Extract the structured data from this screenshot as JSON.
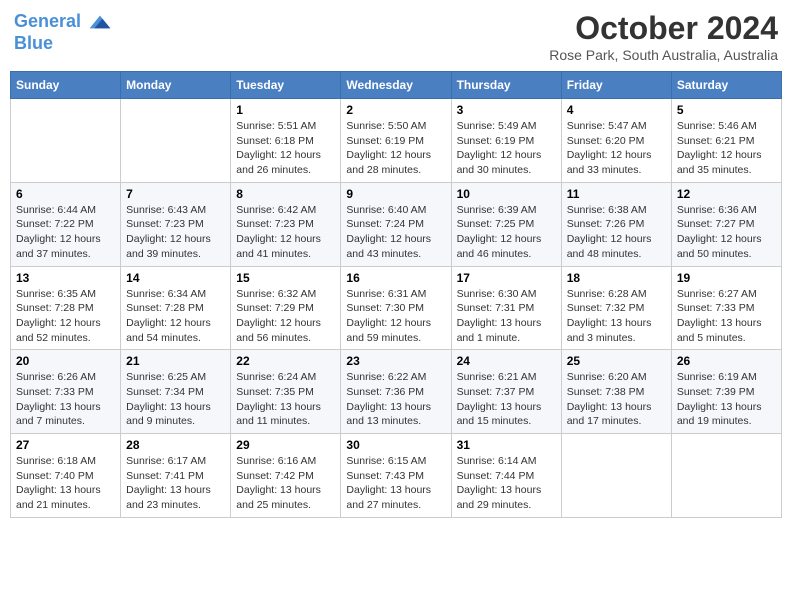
{
  "header": {
    "logo_line1": "General",
    "logo_line2": "Blue",
    "month": "October 2024",
    "location": "Rose Park, South Australia, Australia"
  },
  "days_of_week": [
    "Sunday",
    "Monday",
    "Tuesday",
    "Wednesday",
    "Thursday",
    "Friday",
    "Saturday"
  ],
  "weeks": [
    [
      {
        "day": "",
        "info": ""
      },
      {
        "day": "",
        "info": ""
      },
      {
        "day": "1",
        "info": "Sunrise: 5:51 AM\nSunset: 6:18 PM\nDaylight: 12 hours and 26 minutes."
      },
      {
        "day": "2",
        "info": "Sunrise: 5:50 AM\nSunset: 6:19 PM\nDaylight: 12 hours and 28 minutes."
      },
      {
        "day": "3",
        "info": "Sunrise: 5:49 AM\nSunset: 6:19 PM\nDaylight: 12 hours and 30 minutes."
      },
      {
        "day": "4",
        "info": "Sunrise: 5:47 AM\nSunset: 6:20 PM\nDaylight: 12 hours and 33 minutes."
      },
      {
        "day": "5",
        "info": "Sunrise: 5:46 AM\nSunset: 6:21 PM\nDaylight: 12 hours and 35 minutes."
      }
    ],
    [
      {
        "day": "6",
        "info": "Sunrise: 6:44 AM\nSunset: 7:22 PM\nDaylight: 12 hours and 37 minutes."
      },
      {
        "day": "7",
        "info": "Sunrise: 6:43 AM\nSunset: 7:23 PM\nDaylight: 12 hours and 39 minutes."
      },
      {
        "day": "8",
        "info": "Sunrise: 6:42 AM\nSunset: 7:23 PM\nDaylight: 12 hours and 41 minutes."
      },
      {
        "day": "9",
        "info": "Sunrise: 6:40 AM\nSunset: 7:24 PM\nDaylight: 12 hours and 43 minutes."
      },
      {
        "day": "10",
        "info": "Sunrise: 6:39 AM\nSunset: 7:25 PM\nDaylight: 12 hours and 46 minutes."
      },
      {
        "day": "11",
        "info": "Sunrise: 6:38 AM\nSunset: 7:26 PM\nDaylight: 12 hours and 48 minutes."
      },
      {
        "day": "12",
        "info": "Sunrise: 6:36 AM\nSunset: 7:27 PM\nDaylight: 12 hours and 50 minutes."
      }
    ],
    [
      {
        "day": "13",
        "info": "Sunrise: 6:35 AM\nSunset: 7:28 PM\nDaylight: 12 hours and 52 minutes."
      },
      {
        "day": "14",
        "info": "Sunrise: 6:34 AM\nSunset: 7:28 PM\nDaylight: 12 hours and 54 minutes."
      },
      {
        "day": "15",
        "info": "Sunrise: 6:32 AM\nSunset: 7:29 PM\nDaylight: 12 hours and 56 minutes."
      },
      {
        "day": "16",
        "info": "Sunrise: 6:31 AM\nSunset: 7:30 PM\nDaylight: 12 hours and 59 minutes."
      },
      {
        "day": "17",
        "info": "Sunrise: 6:30 AM\nSunset: 7:31 PM\nDaylight: 13 hours and 1 minute."
      },
      {
        "day": "18",
        "info": "Sunrise: 6:28 AM\nSunset: 7:32 PM\nDaylight: 13 hours and 3 minutes."
      },
      {
        "day": "19",
        "info": "Sunrise: 6:27 AM\nSunset: 7:33 PM\nDaylight: 13 hours and 5 minutes."
      }
    ],
    [
      {
        "day": "20",
        "info": "Sunrise: 6:26 AM\nSunset: 7:33 PM\nDaylight: 13 hours and 7 minutes."
      },
      {
        "day": "21",
        "info": "Sunrise: 6:25 AM\nSunset: 7:34 PM\nDaylight: 13 hours and 9 minutes."
      },
      {
        "day": "22",
        "info": "Sunrise: 6:24 AM\nSunset: 7:35 PM\nDaylight: 13 hours and 11 minutes."
      },
      {
        "day": "23",
        "info": "Sunrise: 6:22 AM\nSunset: 7:36 PM\nDaylight: 13 hours and 13 minutes."
      },
      {
        "day": "24",
        "info": "Sunrise: 6:21 AM\nSunset: 7:37 PM\nDaylight: 13 hours and 15 minutes."
      },
      {
        "day": "25",
        "info": "Sunrise: 6:20 AM\nSunset: 7:38 PM\nDaylight: 13 hours and 17 minutes."
      },
      {
        "day": "26",
        "info": "Sunrise: 6:19 AM\nSunset: 7:39 PM\nDaylight: 13 hours and 19 minutes."
      }
    ],
    [
      {
        "day": "27",
        "info": "Sunrise: 6:18 AM\nSunset: 7:40 PM\nDaylight: 13 hours and 21 minutes."
      },
      {
        "day": "28",
        "info": "Sunrise: 6:17 AM\nSunset: 7:41 PM\nDaylight: 13 hours and 23 minutes."
      },
      {
        "day": "29",
        "info": "Sunrise: 6:16 AM\nSunset: 7:42 PM\nDaylight: 13 hours and 25 minutes."
      },
      {
        "day": "30",
        "info": "Sunrise: 6:15 AM\nSunset: 7:43 PM\nDaylight: 13 hours and 27 minutes."
      },
      {
        "day": "31",
        "info": "Sunrise: 6:14 AM\nSunset: 7:44 PM\nDaylight: 13 hours and 29 minutes."
      },
      {
        "day": "",
        "info": ""
      },
      {
        "day": "",
        "info": ""
      }
    ]
  ]
}
